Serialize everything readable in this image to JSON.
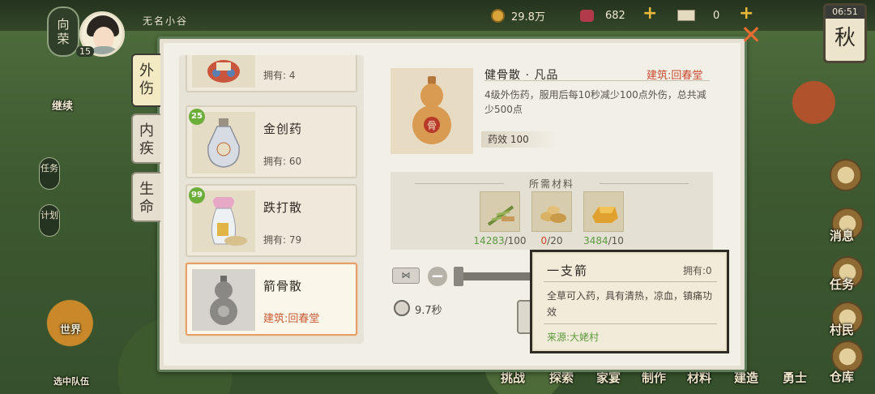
{
  "hud": {
    "rank_label": "向\n荣",
    "player_name": "无名小谷",
    "level": "15",
    "copper": "29.8万",
    "gems": "682",
    "tickets": "0",
    "time": "06:51",
    "season": "秋"
  },
  "left_menu": {
    "continue": "继续",
    "tasks": "任务",
    "plan": "计划",
    "world": "世界",
    "team": "选中队伍"
  },
  "right_menu": {
    "message": "消息",
    "tasks": "任务",
    "villagers": "村民",
    "warehouse": "仓库"
  },
  "bottom_nav": [
    "挑战",
    "探索",
    "家宴",
    "制作",
    "材料",
    "建造",
    "勇士"
  ],
  "tabs": [
    {
      "label": "外伤",
      "active": true
    },
    {
      "label": "内疾",
      "active": false
    },
    {
      "label": "生命",
      "active": false
    }
  ],
  "recipes": [
    {
      "name": "",
      "owned": "拥有: 4",
      "qty": "",
      "icon": "medicine-pot-icon"
    },
    {
      "name": "金创药",
      "owned": "拥有: 60",
      "qty": "25",
      "icon": "medicine-bottle-icon"
    },
    {
      "name": "跌打散",
      "owned": "拥有: 79",
      "qty": "99",
      "icon": "powder-vase-icon"
    },
    {
      "name": "箭骨散",
      "building": "建筑:回春堂",
      "qty": "",
      "icon": "gourd-icon",
      "selected": true
    }
  ],
  "detail": {
    "title": "健骨散 · 凡品",
    "building": "建筑:回春堂",
    "description": "4级外伤药，服用后每10秒减少100点外伤，总共减少500点",
    "efficacy": "药效 100",
    "gourd_mark": "骨"
  },
  "materials": {
    "title": "所需材料",
    "items": [
      {
        "icon": "herb-bundle-icon",
        "have": "14283",
        "need": "/100",
        "ok": true
      },
      {
        "icon": "root-pile-icon",
        "have": "0",
        "need": "/20",
        "ok": false
      },
      {
        "icon": "gold-ingot-icon",
        "have": "3484",
        "need": "/10",
        "ok": true
      }
    ]
  },
  "craft": {
    "time": "9.7秒"
  },
  "tooltip": {
    "name": "一支箭",
    "owned": "拥有:0",
    "description": "全草可入药，具有清热，凉血，镇痛功效",
    "source": "来源:大姥村"
  },
  "colors": {
    "accent_red": "#c94a30",
    "accent_green": "#5b9a3e",
    "panel_border": "#5f7d58"
  }
}
